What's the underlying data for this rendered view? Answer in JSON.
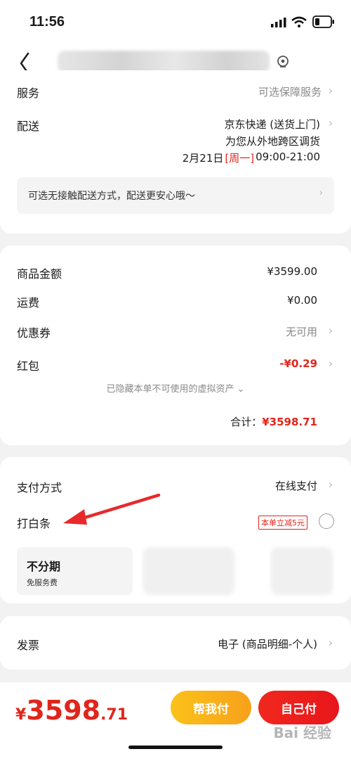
{
  "status": {
    "time": "11:56"
  },
  "header": {
    "icons": [
      "back-arrow-icon",
      "location-pin-icon"
    ]
  },
  "service": {
    "label": "服务",
    "value": "可选保障服务"
  },
  "delivery": {
    "label": "配送",
    "line1": "京东快递 (送货上门)",
    "line2": "为您从外地跨区调货",
    "date": "2月21日",
    "weekday": "[周一]",
    "time": "09:00-21:00"
  },
  "notice": {
    "text": "可选无接触配送方式，配送更安心哦～"
  },
  "price": {
    "goods_label": "商品金额",
    "goods_value": "¥3599.00",
    "shipping_label": "运费",
    "shipping_value": "¥0.00",
    "coupon_label": "优惠券",
    "coupon_value": "无可用",
    "redpacket_label": "红包",
    "redpacket_value": "-¥0.29",
    "hidden_assets": "已隐藏本单不可使用的虚拟资产 ⌄",
    "total_label": "合计：",
    "total_value": "¥3598.71"
  },
  "payment": {
    "method_label": "支付方式",
    "method_value": "在线支付",
    "baitiao_label": "打白条",
    "promo": "本单立减5元",
    "installment_title": "不分期",
    "installment_sub": "免服务费"
  },
  "invoice": {
    "label": "发票",
    "value": "电子 (商品明细-个人)"
  },
  "footer": {
    "amount_symbol": "¥",
    "amount_int": "3598",
    "amount_dec": ".71",
    "help_pay": "帮我付",
    "self_pay": "自己付"
  },
  "watermark": "Bai 经验",
  "colors": {
    "brand_red": "#e1251b",
    "orange": "#f9a61a",
    "pay_red": "#f0281e"
  }
}
